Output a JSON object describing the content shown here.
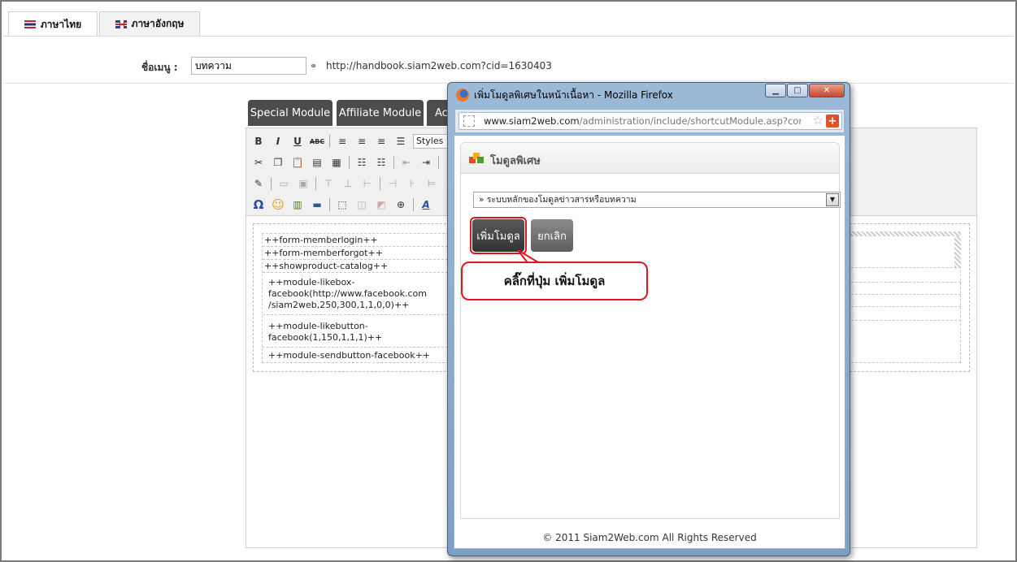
{
  "tabs": [
    {
      "label": "ภาษาไทย",
      "flag": "thai-flag-icon",
      "active": true
    },
    {
      "label": "ภาษาอังกฤษ",
      "flag": "uk-flag-icon",
      "active": false
    }
  ],
  "menu": {
    "label": "ชื่อเมนู :",
    "value": "บทความ",
    "url": "http://handbook.siam2web.com?cid=1630403"
  },
  "module_buttons": [
    "Special Module",
    "Affiliate Module",
    "Ac"
  ],
  "editor": {
    "styles_label": "Styles",
    "content_lines": [
      "++form-memberlogin++",
      "++form-memberforgot++",
      "++showproduct-catalog++",
      "++module-likebox-",
      "facebook(http://www.facebook.com",
      "/siam2web,250,300,1,1,0,0)++",
      "++module-likebutton-",
      "facebook(1,150,1,1,1)++",
      "++module-sendbutton-facebook++"
    ]
  },
  "popup": {
    "window_title": "เพิ่มโมดูลพิเศษในหน้าเนื้อหา - Mozilla Firefox",
    "address_host": "www.siam2web.com",
    "address_path": "/administration/include/shortcutModule.asp?conte",
    "panel_title": "โมดูลพิเศษ",
    "select_value": "» ระบบหลักของโมดูลข่าวสารหรือบทความ",
    "add_button": "เพิ่มโมดูล",
    "cancel_button": "ยกเลิก",
    "callout": "คลิ๊กที่ปุ่ม เพิ่มโมดูล",
    "footer": "© 2011 Siam2Web.com All Rights Reserved"
  },
  "colors": {
    "accent_red": "#e0161d",
    "module_tab_bg": "#4c4c4c",
    "window_chrome": "#9cb9d8"
  }
}
